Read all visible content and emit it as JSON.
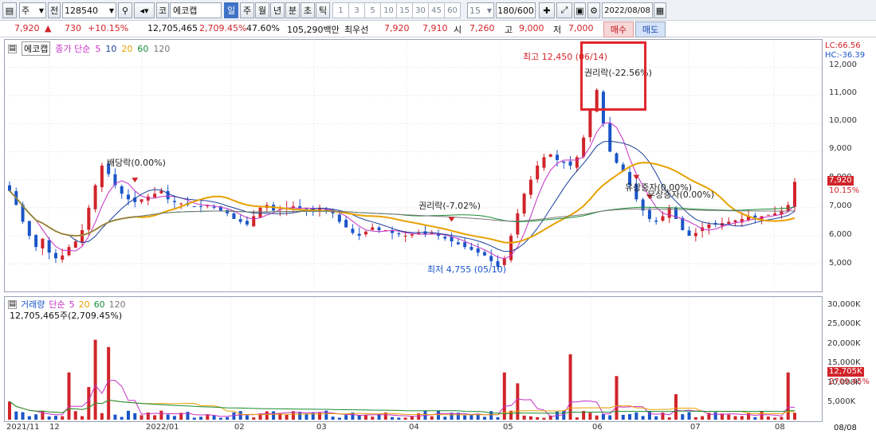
{
  "toolbar": {
    "period_select": "주",
    "prev_label": "전",
    "stock_code": "128540",
    "market_prefix": "코",
    "stock_name": "에코캡",
    "period_tabs": [
      "일",
      "주",
      "월",
      "년",
      "분",
      "초",
      "틱"
    ],
    "active_period": "일",
    "minute_buttons": [
      "1",
      "3",
      "5",
      "10",
      "15",
      "30",
      "45",
      "60"
    ],
    "interval_value": "15",
    "count_display": "180/600",
    "date_value": "2022/08/08"
  },
  "quote": {
    "price": "7,920",
    "change": "730",
    "change_pct": "+10.15%",
    "volume": "12,705,465",
    "volume_ratio": "2,709.45%",
    "turnover": "47.60%",
    "amount": "105,290백만",
    "bid_label": "최우선",
    "ask1": "7,920",
    "bid1": "7,910",
    "open_label": "시",
    "open": "7,260",
    "high_label": "고",
    "high": "9,000",
    "low_label": "저",
    "low": "7,000",
    "buy_label": "매수",
    "sell_label": "매도"
  },
  "chart_header": {
    "name": "에코캡",
    "ma_label": "종가 단순",
    "ma_periods": [
      "5",
      "10",
      "20",
      "60",
      "120"
    ],
    "lc": "LC:66.56",
    "hc": "HC:-36.39"
  },
  "volume_header": {
    "name": "거래량",
    "ma_label": "단순",
    "ma_periods": [
      "5",
      "20",
      "60",
      "120"
    ],
    "current": "12,705,465주(2,709.45%)"
  },
  "annotations": {
    "high": "최고 12,450 (06/14)",
    "low": "최저 4,755 (05/10)",
    "dividend": "배당락(0.00%)",
    "rights1": "권리락(-7.02%)",
    "rights2": "권리락(-22.56%)",
    "capinc1": "유상증자(0.00%)",
    "capinc2": "무상증자(0.00%)"
  },
  "right_axis": {
    "price_ticks": [
      "12,000",
      "11,000",
      "10,000",
      "9,000",
      "8,000",
      "7,000",
      "6,000",
      "5,000"
    ],
    "volume_ticks": [
      "30,000K",
      "25,000K",
      "20,000K",
      "15,000K",
      "10,000K",
      "5,000K"
    ],
    "price_tag": "7,920",
    "price_tag_pct": "10.15%",
    "vol_tag": "12,705K",
    "vol_tag_pct": "2709.45%",
    "last_date": "08/08"
  },
  "x_axis": [
    "2021/11",
    "12",
    "2022/01",
    "02",
    "03",
    "04",
    "05",
    "06",
    "07",
    "08"
  ],
  "colors": {
    "up": "#d0242a",
    "down": "#1a55c8",
    "ma5": "#c630c6",
    "ma10": "#1b3f9c",
    "ma20": "#e7a100",
    "ma60": "#198c33",
    "ma120": "#777777"
  },
  "chart_data": {
    "type": "candlestick",
    "y_range": [
      4300,
      12700
    ],
    "closes": [
      7600,
      7100,
      6500,
      6000,
      5600,
      5900,
      5400,
      5200,
      5300,
      5600,
      5800,
      6200,
      7000,
      7800,
      8500,
      8200,
      7800,
      7500,
      7300,
      7200,
      7300,
      7400,
      7500,
      7600,
      7300,
      7200,
      7150,
      7100,
      7050,
      7050,
      7100,
      7000,
      6900,
      6800,
      6600,
      6500,
      6400,
      6700,
      7000,
      7100,
      6900,
      6950,
      7000,
      7050,
      7000,
      6950,
      6900,
      7000,
      6900,
      6800,
      6500,
      6300,
      6100,
      6000,
      6150,
      6300,
      6200,
      6200,
      6100,
      6050,
      6000,
      6050,
      6100,
      6050,
      6100,
      6000,
      5900,
      5800,
      5700,
      5600,
      5500,
      5400,
      5300,
      5100,
      4900,
      5200,
      6000,
      6800,
      7500,
      8000,
      8500,
      8800,
      8900,
      8700,
      8600,
      8500,
      8800,
      9500,
      10500,
      11200,
      10000,
      9000,
      8600,
      8300,
      7800,
      7300,
      6900,
      6600,
      6500,
      6700,
      7000,
      6600,
      6200,
      6000,
      6100,
      6300,
      6400,
      6400,
      6450,
      6500,
      6550,
      6600,
      6700,
      6650,
      6700,
      6750,
      6800,
      6900,
      7100,
      7920
    ]
  }
}
